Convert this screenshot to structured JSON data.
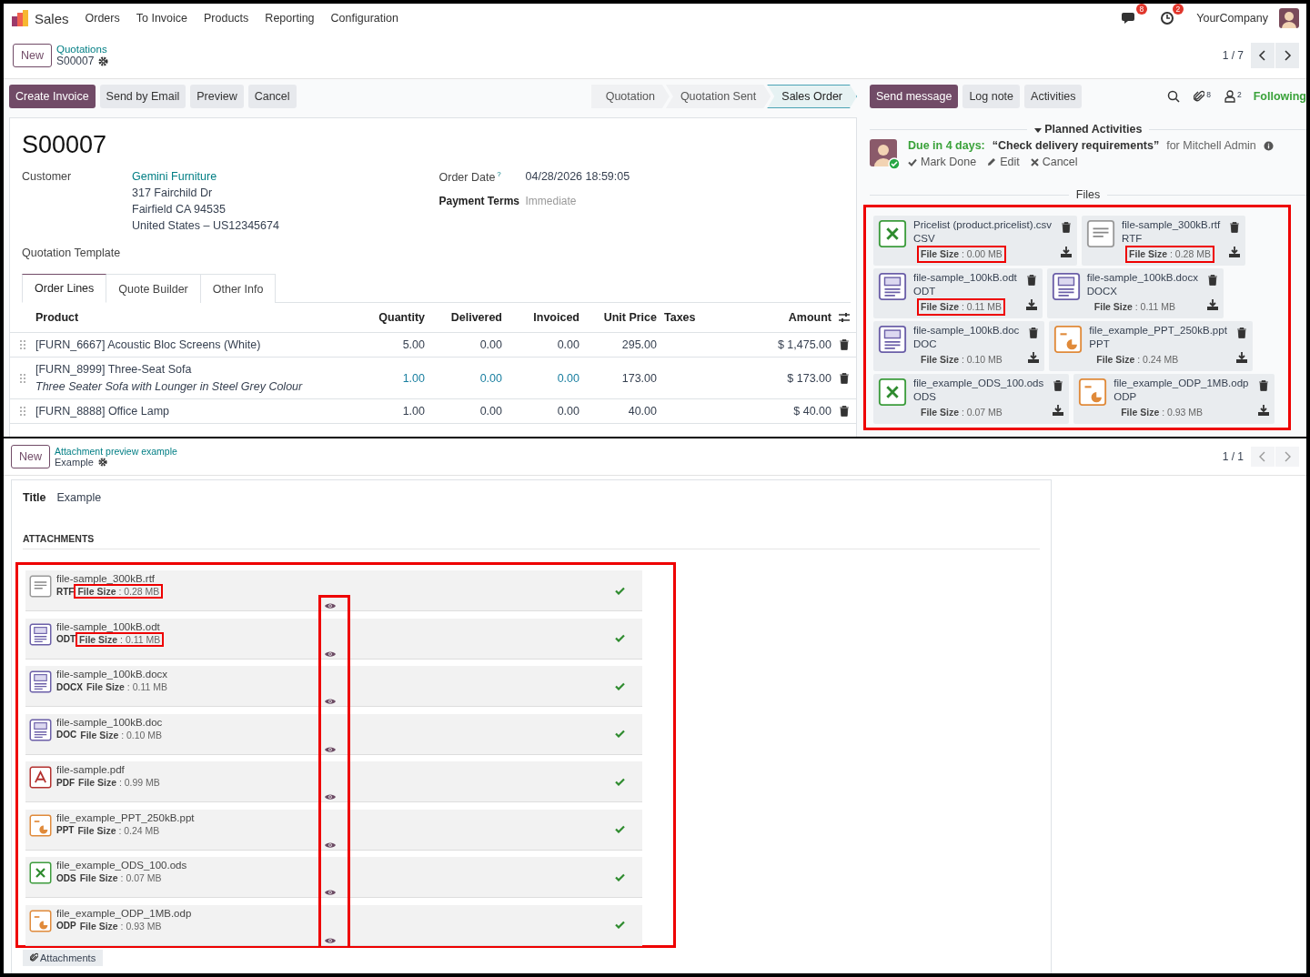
{
  "navbar": {
    "app": "Sales",
    "menu": [
      "Orders",
      "To Invoice",
      "Products",
      "Reporting",
      "Configuration"
    ],
    "messages_count": "8",
    "activities_count": "2",
    "company": "YourCompany"
  },
  "order_form": {
    "new_button": "New",
    "breadcrumb": "Quotations",
    "record": "S00007",
    "pager": "1 / 7",
    "actions": [
      {
        "label": "Create Invoice",
        "primary": true
      },
      {
        "label": "Send by Email",
        "primary": false
      },
      {
        "label": "Preview",
        "primary": false
      },
      {
        "label": "Cancel",
        "primary": false
      }
    ],
    "statusbar": [
      {
        "label": "Quotation",
        "selected": false
      },
      {
        "label": "Quotation Sent",
        "selected": false
      },
      {
        "label": "Sales Order",
        "selected": true
      }
    ],
    "name": "S00007",
    "customer_label": "Customer",
    "customer": "Gemini Furniture",
    "address": [
      "317 Fairchild Dr",
      "Fairfield CA 94535",
      "United States – US12345674"
    ],
    "template_label": "Quotation Template",
    "order_date_label": "Order Date",
    "help_mark": "?",
    "order_date": "04/28/2026 18:59:05",
    "payment_terms_label": "Payment Terms",
    "payment_terms_placeholder": "Immediate",
    "tabs": [
      {
        "label": "Order Lines",
        "selected": true
      },
      {
        "label": "Quote Builder",
        "selected": false
      },
      {
        "label": "Other Info",
        "selected": false
      }
    ],
    "columns": [
      "Product",
      "Quantity",
      "Delivered",
      "Invoiced",
      "Unit Price",
      "Taxes",
      "Amount"
    ],
    "rows": [
      {
        "product": "[FURN_6667] Acoustic Bloc Screens (White)",
        "quantity": "5.00",
        "delivered": "0.00",
        "invoiced": "0.00",
        "unit_price": "295.00",
        "amount": "$ 1,475.00",
        "linked": false
      },
      {
        "product": "[FURN_8999] Three-Seat Sofa",
        "description": "Three Seater Sofa with Lounger in Steel Grey Colour",
        "quantity": "1.00",
        "delivered": "0.00",
        "invoiced": "0.00",
        "unit_price": "173.00",
        "amount": "$ 173.00",
        "linked": true
      },
      {
        "product": "[FURN_8888] Office Lamp",
        "quantity": "1.00",
        "delivered": "0.00",
        "invoiced": "0.00",
        "unit_price": "40.00",
        "amount": "$ 40.00",
        "linked": false
      }
    ]
  },
  "chatter": {
    "buttons": [
      {
        "label": "Send message",
        "primary": true
      },
      {
        "label": "Log note",
        "primary": false
      },
      {
        "label": "Activities",
        "primary": false
      }
    ],
    "attachments_count": "8",
    "followers_count": "2",
    "follow": "Following",
    "planned_title": "Planned Activities",
    "activity": {
      "due": "Due in 4 days:",
      "summary": "“Check delivery requirements”",
      "assignee": "for Mitchell Admin",
      "actions": [
        {
          "label": "Mark Done",
          "kind": "done"
        },
        {
          "label": "Edit",
          "kind": "edit"
        },
        {
          "label": "Cancel",
          "kind": "cancel"
        }
      ]
    },
    "files_title": "Files",
    "files": [
      {
        "name": "Pricelist (product.pricelist).csv",
        "type": "CSV",
        "size": "**File Size** : 0.00 MB",
        "kind": "sheet",
        "highlighted": true
      },
      {
        "name": "file-sample_300kB.rtf",
        "type": "RTF",
        "size": "**File Size** : 0.28 MB",
        "kind": "text",
        "highlighted": true
      },
      {
        "name": "file-sample_100kB.odt",
        "type": "ODT",
        "size": "**File Size** : 0.11 MB",
        "kind": "doc",
        "highlighted": true
      },
      {
        "name": "file-sample_100kB.docx",
        "type": "DOCX",
        "size": "**File Size** : 0.11 MB",
        "kind": "doc",
        "highlighted": false
      },
      {
        "name": "file-sample_100kB.doc",
        "type": "DOC",
        "size": "**File Size** : 0.10 MB",
        "kind": "doc",
        "highlighted": false
      },
      {
        "name": "file_example_PPT_250kB.ppt",
        "type": "PPT",
        "size": "**File Size** : 0.24 MB",
        "kind": "slides",
        "highlighted": false
      },
      {
        "name": "file_example_ODS_100.ods",
        "type": "ODS",
        "size": "**File Size** : 0.07 MB",
        "kind": "sheet",
        "highlighted": false
      },
      {
        "name": "file_example_ODP_1MB.odp",
        "type": "ODP",
        "size": "**File Size** : 0.93 MB",
        "kind": "slides",
        "highlighted": false
      }
    ]
  },
  "attachment_form": {
    "new_button": "New",
    "breadcrumb": "Attachment preview example",
    "record": "Example",
    "pager": "1 / 1",
    "title_label": "Title",
    "title": "Example",
    "section": "ATTACHMENTS",
    "attachments": [
      {
        "name": "file-sample_300kB.rtf",
        "type": "RTF",
        "size": "**File Size** : 0.28 MB",
        "kind": "text",
        "highlighted": true
      },
      {
        "name": "file-sample_100kB.odt",
        "type": "ODT",
        "size": "**File Size** : 0.11 MB",
        "kind": "doc",
        "highlighted": true
      },
      {
        "name": "file-sample_100kB.docx",
        "type": "DOCX",
        "size": "**File Size** : 0.11 MB",
        "kind": "doc",
        "highlighted": false
      },
      {
        "name": "file-sample_100kB.doc",
        "type": "DOC",
        "size": "**File Size** : 0.10 MB",
        "kind": "doc",
        "highlighted": false
      },
      {
        "name": "file-sample.pdf",
        "type": "PDF",
        "size": "**File Size** : 0.99 MB",
        "kind": "pdf",
        "highlighted": false
      },
      {
        "name": "file_example_PPT_250kB.ppt",
        "type": "PPT",
        "size": "**File Size** : 0.24 MB",
        "kind": "slides",
        "highlighted": false
      },
      {
        "name": "file_example_ODS_100.ods",
        "type": "ODS",
        "size": "**File Size** : 0.07 MB",
        "kind": "sheet",
        "highlighted": false
      },
      {
        "name": "file_example_ODP_1MB.odp",
        "type": "ODP",
        "size": "**File Size** : 0.93 MB",
        "kind": "slides",
        "highlighted": false
      }
    ],
    "attachments_button": "Attachments"
  }
}
